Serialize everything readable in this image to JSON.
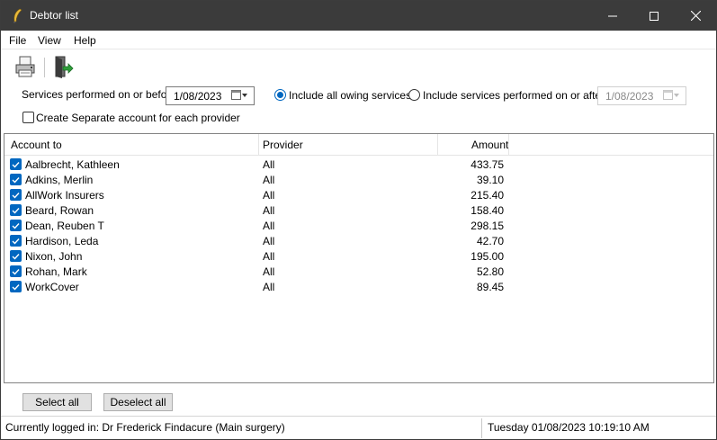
{
  "window": {
    "title": "Debtor list",
    "controls": {
      "minimize": "—",
      "maximize": "☐",
      "close": "✕"
    }
  },
  "menu": [
    "File",
    "View",
    "Help"
  ],
  "toolbar": {
    "print_icon": "printer-icon",
    "exit_icon": "exit-door-icon"
  },
  "filters": {
    "services_before_label": "Services performed on or before:",
    "services_before_date": "1/08/2023",
    "include_all_label": "Include all owing services",
    "include_all_selected": true,
    "include_after_label": "Include services performed on or after",
    "include_after_date": "1/08/2023",
    "separate_account_label": "Create Separate account for each provider",
    "separate_account_checked": false
  },
  "table": {
    "columns": [
      "Account to",
      "Provider",
      "Amount"
    ],
    "rows": [
      {
        "account": "Aalbrecht, Kathleen",
        "provider": "All",
        "amount": "433.75",
        "checked": true
      },
      {
        "account": "Adkins, Merlin",
        "provider": "All",
        "amount": "39.10",
        "checked": true
      },
      {
        "account": "AllWork Insurers",
        "provider": "All",
        "amount": "215.40",
        "checked": true
      },
      {
        "account": "Beard, Rowan",
        "provider": "All",
        "amount": "158.40",
        "checked": true
      },
      {
        "account": "Dean, Reuben T",
        "provider": "All",
        "amount": "298.15",
        "checked": true
      },
      {
        "account": "Hardison, Leda",
        "provider": "All",
        "amount": "42.70",
        "checked": true
      },
      {
        "account": "Nixon, John",
        "provider": "All",
        "amount": "195.00",
        "checked": true
      },
      {
        "account": "Rohan, Mark",
        "provider": "All",
        "amount": "52.80",
        "checked": true
      },
      {
        "account": "WorkCover",
        "provider": "All",
        "amount": "89.45",
        "checked": true
      }
    ]
  },
  "buttons": {
    "select_all": "Select all",
    "deselect_all": "Deselect all"
  },
  "status": {
    "logged_in": "Currently logged in:  Dr Frederick Findacure (Main surgery)",
    "datetime": "Tuesday 01/08/2023 10:19:10 AM"
  },
  "colors": {
    "titlebar": "#3b3b3b",
    "accent": "#0067c0"
  }
}
